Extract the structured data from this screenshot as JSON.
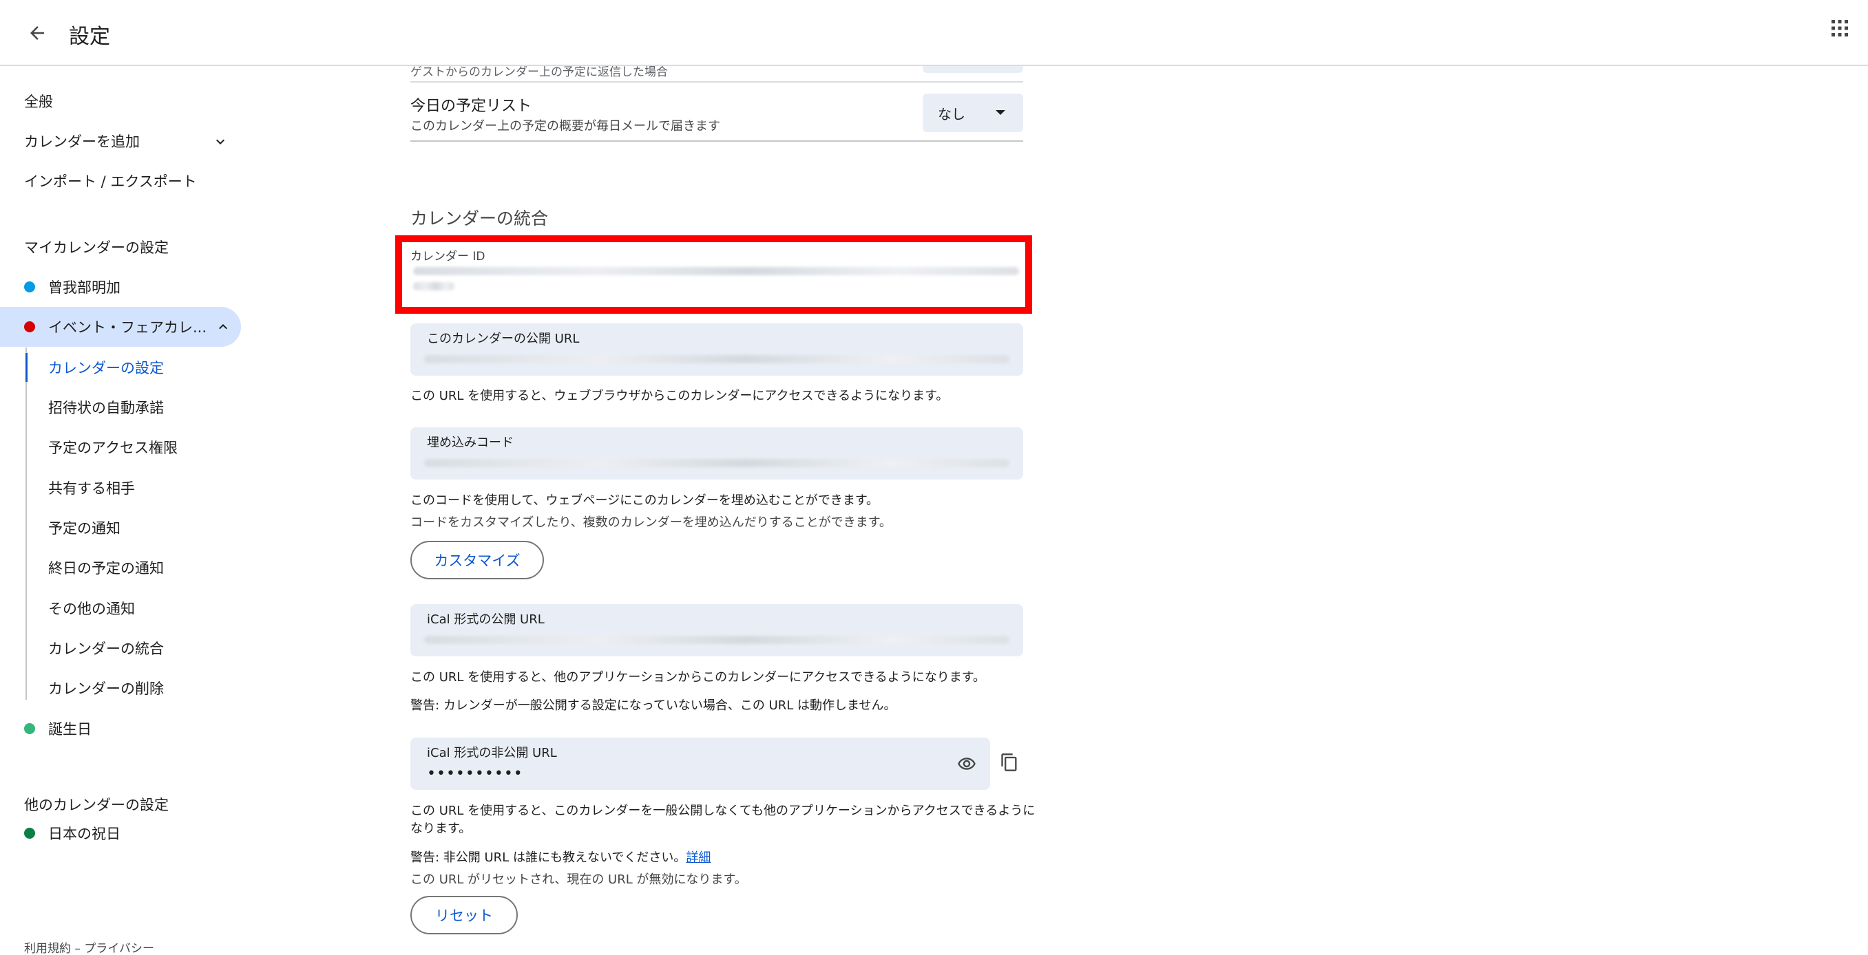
{
  "header": {
    "title": "設定",
    "back_icon": "arrow-back-icon",
    "apps_icon": "apps-grid-icon"
  },
  "sidebar": {
    "general": "全般",
    "add_calendar": "カレンダーを追加",
    "import_export": "インポート / エクスポート",
    "my_calendars_heading": "マイカレンダーの設定",
    "my_calendars": [
      {
        "label": "曾我部明加",
        "color": "#039be5"
      },
      {
        "label": "イベント・フェアカレ...",
        "color": "#d50000",
        "expanded": true
      },
      {
        "label": "誕生日",
        "color": "#33b679"
      }
    ],
    "sub_items": [
      "カレンダーの設定",
      "招待状の自動承諾",
      "予定のアクセス権限",
      "共有する相手",
      "予定の通知",
      "終日の予定の通知",
      "その他の通知",
      "カレンダーの統合",
      "カレンダーの削除"
    ],
    "other_calendars_heading": "他のカレンダーの設定",
    "other_calendars": [
      {
        "label": "日本の祝日",
        "color": "#0b8043"
      }
    ],
    "footer": "利用規約 – プライバシー"
  },
  "main": {
    "partial_row_sub": "ゲストからのカレンダー上の予定に返信した場合",
    "daily_agenda": {
      "title": "今日の予定リスト",
      "subtitle": "このカレンダー上の予定の概要が毎日メールで届きます",
      "value": "なし"
    },
    "integration": {
      "title": "カレンダーの統合",
      "calendar_id_label": "カレンダー ID",
      "public_url_label": "このカレンダーの公開 URL",
      "public_url_help": "この URL を使用すると、ウェブブラウザからこのカレンダーにアクセスできるようになります。",
      "embed_label": "埋め込みコード",
      "embed_help_1": "このコードを使用して、ウェブページにこのカレンダーを埋め込むことができます。",
      "embed_help_2": "コードをカスタマイズしたり、複数のカレンダーを埋め込んだりすることができます。",
      "customize_button": "カスタマイズ",
      "ical_public_label": "iCal 形式の公開 URL",
      "ical_public_help": "この URL を使用すると、他のアプリケーションからこのカレンダーにアクセスできるようになります。",
      "ical_public_warning": "警告: カレンダーが一般公開する設定になっていない場合、この URL は動作しません。",
      "ical_private_label": "iCal 形式の非公開 URL",
      "ical_private_value": "••••••••••",
      "ical_private_help_1": "この URL を使用すると、このカレンダーを一般公開しなくても他のアプリケーションからアクセスできるように",
      "ical_private_help_2": "なります。",
      "ical_private_warning": "警告: 非公開 URL は誰にも教えないでください。",
      "details_link": "詳細",
      "reset_note": "この URL がリセットされ、現在の URL が無効になります。",
      "reset_button": "リセット",
      "highlight_color": "#ff0000"
    }
  }
}
